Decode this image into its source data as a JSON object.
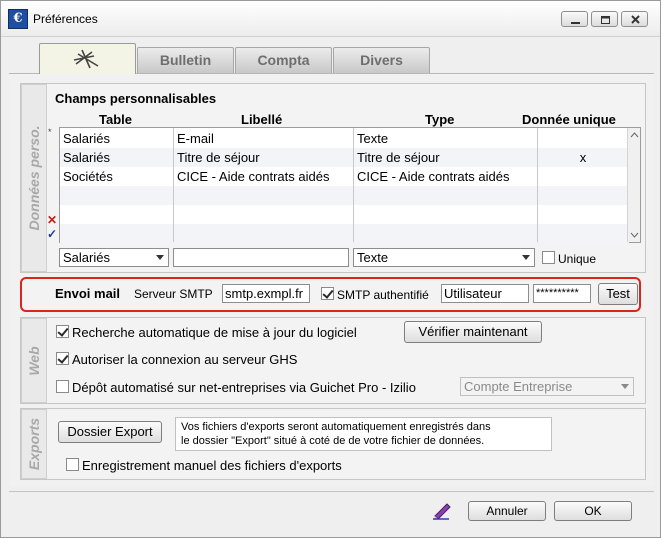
{
  "window": {
    "title": "Préférences"
  },
  "tabs": [
    "Bulletin",
    "Compta",
    "Divers"
  ],
  "sections": {
    "donnees": "Données perso.",
    "web": "Web",
    "exports": "Exports"
  },
  "champs": {
    "title": "Champs personnalisables",
    "headers": {
      "table": "Table",
      "libelle": "Libellé",
      "type": "Type",
      "unique": "Donnée unique"
    },
    "rows": [
      {
        "table": "Salariés",
        "libelle": "E-mail",
        "type": "Texte",
        "unique": ""
      },
      {
        "table": "Salariés",
        "libelle": "Titre de séjour",
        "type": "Titre de séjour",
        "unique": "x"
      },
      {
        "table": "Sociétés",
        "libelle": "CICE - Aide contrats aidés",
        "type": "CICE - Aide contrats aidés",
        "unique": ""
      }
    ],
    "table_select": "Salariés",
    "libelle_input": "",
    "type_select": "Texte",
    "unique_label": "Unique"
  },
  "mail": {
    "title": "Envoi mail",
    "smtp_label": "Serveur SMTP",
    "smtp_value": "smtp.exmpl.fr",
    "auth_label": "SMTP authentifié",
    "user_value": "Utilisateur",
    "password_value": "**********",
    "test_label": "Test"
  },
  "web": {
    "auto_update_label": "Recherche automatique de mise à jour du logiciel",
    "verify_label": "Vérifier maintenant",
    "ghs_label": "Autoriser la connexion au serveur GHS",
    "depot_label": "Dépôt automatisé sur net-entreprises via Guichet Pro - Izilio",
    "compte_select": "Compte Entreprise"
  },
  "exports": {
    "dossier_label": "Dossier Export",
    "info_line1": "Vos fichiers d'exports seront automatiquement enregistrés dans",
    "info_line2": "le dossier \"Export\" situé à coté de de votre fichier de données.",
    "manual_label": "Enregistrement manuel des fichiers d'exports"
  },
  "footer": {
    "annuler": "Annuler",
    "ok": "OK"
  },
  "colors": {
    "highlight_border": "#d7261e",
    "row_mark_delete": "#c0201a",
    "row_mark_validate": "#1a3a9a"
  }
}
